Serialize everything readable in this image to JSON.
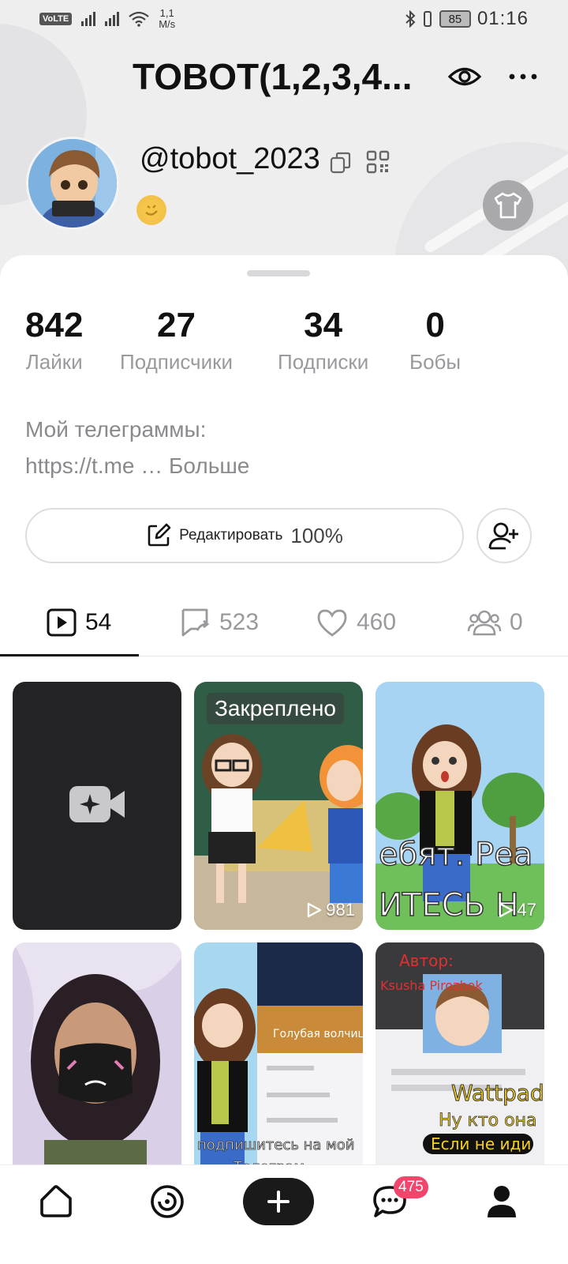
{
  "status_bar": {
    "volte": "VoLTE",
    "net_speed_value": "1,1",
    "net_speed_unit": "M/s",
    "battery": "85",
    "time": "01:16"
  },
  "header": {
    "title": "TOBOT(1,2,3,4...",
    "username": "@tobot_2023"
  },
  "stats": [
    {
      "value": "842",
      "label": "Лайки"
    },
    {
      "value": "27",
      "label": "Подписчики"
    },
    {
      "value": "34",
      "label": "Подписки"
    },
    {
      "value": "0",
      "label": "Бобы"
    }
  ],
  "bio": {
    "line1": "Мой телеграммы:",
    "line2": "https://t.me … Больше"
  },
  "edit": {
    "label": "Редактировать",
    "percent": "100%"
  },
  "tabs": [
    {
      "icon": "video-play-icon",
      "count": "54"
    },
    {
      "icon": "repost-icon",
      "count": "523"
    },
    {
      "icon": "heart-icon",
      "count": "460"
    },
    {
      "icon": "group-icon",
      "count": "0"
    }
  ],
  "videos": [
    {
      "type": "drafts-placeholder"
    },
    {
      "pinned_label": "Закреплено",
      "views": "981"
    },
    {
      "views": "47"
    },
    {
      "views": ""
    },
    {
      "views": ""
    },
    {
      "views": ""
    }
  ],
  "nav": {
    "messages_badge": "475"
  },
  "colors": {
    "accent_badge": "#f2456b",
    "text_primary": "#111111",
    "text_secondary": "#9a9a9e"
  }
}
